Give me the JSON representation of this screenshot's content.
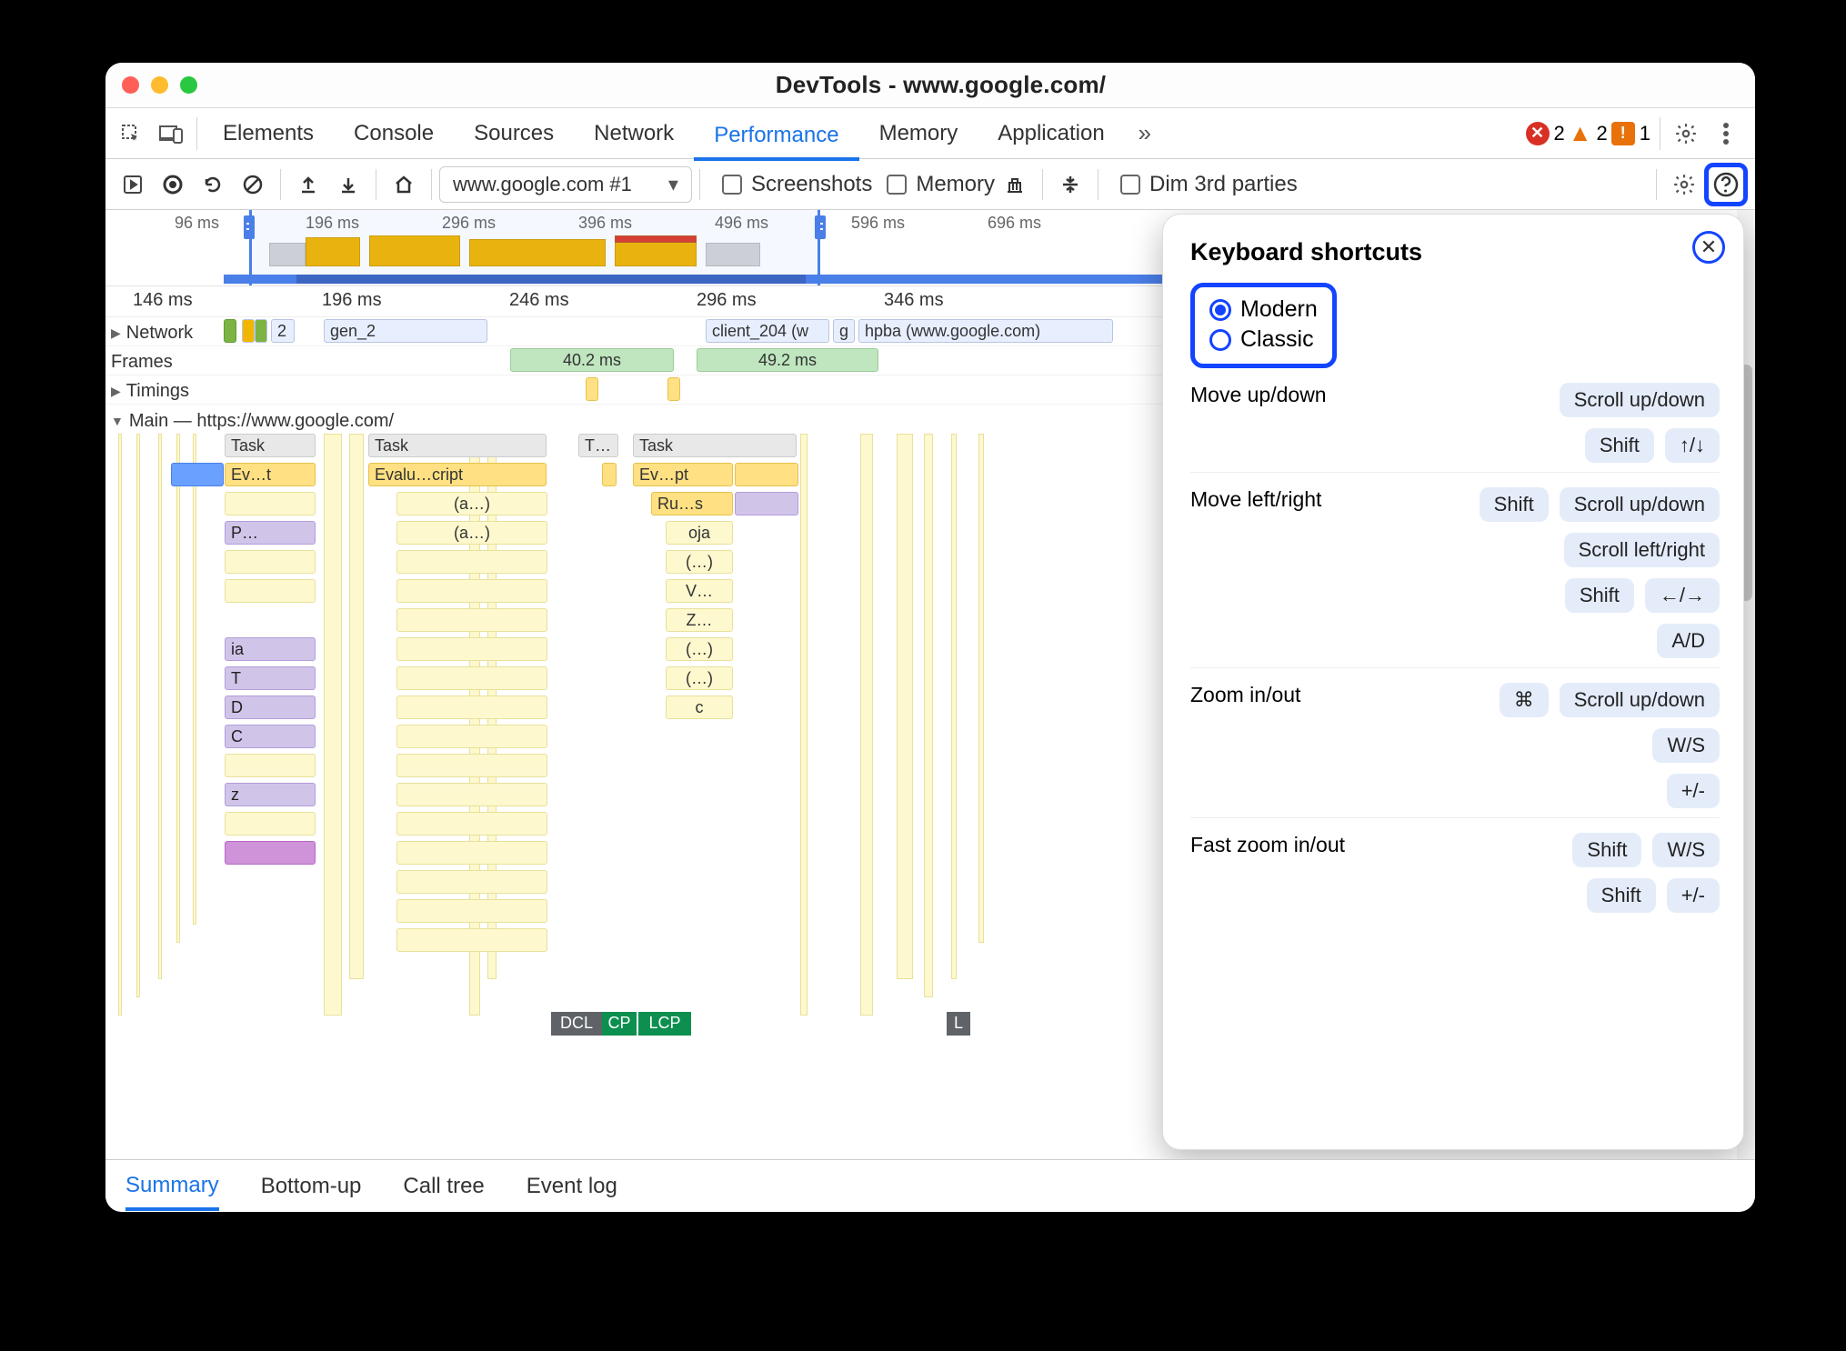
{
  "window_title": "DevTools - www.google.com/",
  "tabs": [
    "Elements",
    "Console",
    "Sources",
    "Network",
    "Performance",
    "Memory",
    "Application"
  ],
  "active_tab": "Performance",
  "badges": {
    "errors": "2",
    "warnings": "2",
    "issues": "1"
  },
  "toolbar": {
    "url_label": "www.google.com #1",
    "screenshots_label": "Screenshots",
    "memory_label": "Memory",
    "dim_label": "Dim 3rd parties"
  },
  "mini_ticks": [
    "96 ms",
    "196 ms",
    "296 ms",
    "396 ms",
    "496 ms",
    "596 ms",
    "696 ms"
  ],
  "ruler_ticks": [
    "146 ms",
    "196 ms",
    "246 ms",
    "296 ms",
    "346 ms"
  ],
  "tracks": {
    "network_label": "Network",
    "network_items": {
      "n2": "2",
      "gen2": "gen_2",
      "client204": "client_204 (w",
      "g": "g",
      "hpba": "hpba (www.google.com)"
    },
    "frames_label": "Frames",
    "frames_items": {
      "f1": "40.2 ms",
      "f2": "49.2 ms"
    },
    "timings_label": "Timings",
    "main_label": "Main — https://www.google.com/",
    "dcl": "DCL",
    "cp": "CP",
    "lcp": "LCP",
    "l": "L",
    "tasks": {
      "task1": "Task",
      "task2": "Task",
      "task3": "T…",
      "task4": "Task",
      "ev1": "Ev…t",
      "eval": "Evalu…cript",
      "evpt": "Ev…pt",
      "a1": "(a…)",
      "a2": "(a…)",
      "p": "P…",
      "rums": "Ru…s",
      "oja": "oja",
      "e1": "(…)",
      "v": "V…",
      "z": "Z…",
      "e2": "(…)",
      "e3": "(…)",
      "c": "c",
      "ia": "ia",
      "t": "T",
      "d": "D",
      "cC": "C",
      "zz": "z"
    }
  },
  "bottom_tabs": [
    "Summary",
    "Bottom-up",
    "Call tree",
    "Event log"
  ],
  "active_bottom_tab": "Summary",
  "panel": {
    "title": "Keyboard shortcuts",
    "modes": {
      "modern": "Modern",
      "classic": "Classic",
      "selected": "Modern"
    },
    "rows": [
      {
        "label": "Move up/down",
        "keys": [
          [
            "Scroll up/down"
          ],
          [
            "Shift",
            "↑/↓"
          ]
        ]
      },
      {
        "label": "Move left/right",
        "keys": [
          [
            "Shift",
            "Scroll up/down"
          ],
          [
            "Scroll left/right"
          ],
          [
            "Shift",
            "←/→"
          ],
          [
            "A/D"
          ]
        ]
      },
      {
        "label": "Zoom in/out",
        "keys": [
          [
            "⌘",
            "Scroll up/down"
          ],
          [
            "W/S"
          ],
          [
            "+/-"
          ]
        ]
      },
      {
        "label": "Fast zoom in/out",
        "keys": [
          [
            "Shift",
            "W/S"
          ],
          [
            "Shift",
            "+/-"
          ]
        ]
      }
    ]
  }
}
